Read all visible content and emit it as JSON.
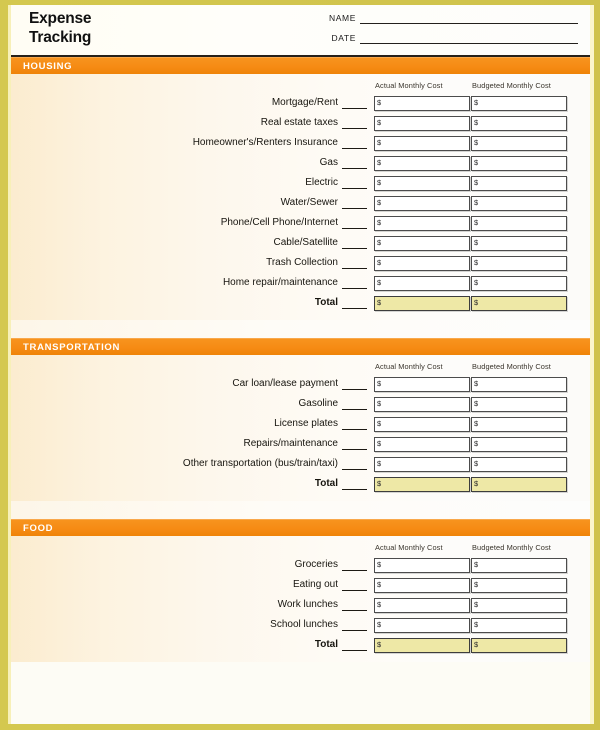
{
  "document": {
    "title": "Expense\nTracking",
    "name_label": "NAME",
    "date_label": "DATE",
    "name_value": "",
    "date_value": "",
    "watermark": ""
  },
  "columns": {
    "actual": "Actual Monthly Cost",
    "budgeted": "Budgeted Monthly Cost"
  },
  "currency_symbol": "$",
  "colors": {
    "section_bar": "#f7941e",
    "frame": "#cfc24c",
    "total_fill": "#eee8a6",
    "box_border": "#4c4c4c"
  },
  "sections": [
    {
      "title": "HOUSING",
      "rows": [
        {
          "label": "Mortgage/Rent",
          "actual": "",
          "budgeted": "",
          "total": false
        },
        {
          "label": "Real estate taxes",
          "actual": "",
          "budgeted": "",
          "total": false
        },
        {
          "label": "Homeowner's/Renters Insurance",
          "actual": "",
          "budgeted": "",
          "total": false
        },
        {
          "label": "Gas",
          "actual": "",
          "budgeted": "",
          "total": false
        },
        {
          "label": "Electric",
          "actual": "",
          "budgeted": "",
          "total": false
        },
        {
          "label": "Water/Sewer",
          "actual": "",
          "budgeted": "",
          "total": false
        },
        {
          "label": "Phone/Cell Phone/Internet",
          "actual": "",
          "budgeted": "",
          "total": false
        },
        {
          "label": "Cable/Satellite",
          "actual": "",
          "budgeted": "",
          "total": false
        },
        {
          "label": "Trash Collection",
          "actual": "",
          "budgeted": "",
          "total": false
        },
        {
          "label": "Home repair/maintenance",
          "actual": "",
          "budgeted": "",
          "total": false
        },
        {
          "label": "Total",
          "actual": "",
          "budgeted": "",
          "total": true
        }
      ]
    },
    {
      "title": "TRANSPORTATION",
      "rows": [
        {
          "label": "Car loan/lease payment",
          "actual": "",
          "budgeted": "",
          "total": false
        },
        {
          "label": "Gasoline",
          "actual": "",
          "budgeted": "",
          "total": false
        },
        {
          "label": "License plates",
          "actual": "",
          "budgeted": "",
          "total": false
        },
        {
          "label": "Repairs/maintenance",
          "actual": "",
          "budgeted": "",
          "total": false
        },
        {
          "label": "Other transportation (bus/train/taxi)",
          "actual": "",
          "budgeted": "",
          "total": false
        },
        {
          "label": "Total",
          "actual": "",
          "budgeted": "",
          "total": true
        }
      ]
    },
    {
      "title": "FOOD",
      "rows": [
        {
          "label": "Groceries",
          "actual": "",
          "budgeted": "",
          "total": false
        },
        {
          "label": "Eating out",
          "actual": "",
          "budgeted": "",
          "total": false
        },
        {
          "label": "Work lunches",
          "actual": "",
          "budgeted": "",
          "total": false
        },
        {
          "label": "School lunches",
          "actual": "",
          "budgeted": "",
          "total": false
        },
        {
          "label": "Total",
          "actual": "",
          "budgeted": "",
          "total": true
        }
      ]
    }
  ]
}
